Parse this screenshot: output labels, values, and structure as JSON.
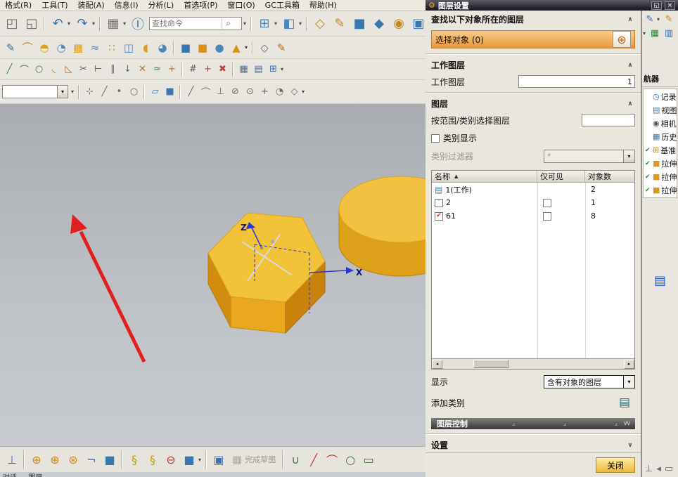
{
  "menu": {
    "items": [
      {
        "name": "menu-format",
        "label": "格式(R)"
      },
      {
        "name": "menu-tools",
        "label": "工具(T)"
      },
      {
        "name": "menu-assemblies",
        "label": "装配(A)"
      },
      {
        "name": "menu-information",
        "label": "信息(I)"
      },
      {
        "name": "menu-analysis",
        "label": "分析(L)"
      },
      {
        "name": "menu-preferences",
        "label": "首选项(P)"
      },
      {
        "name": "menu-window",
        "label": "窗口(O)"
      },
      {
        "name": "menu-gc-toolbox",
        "label": "GC工具箱"
      },
      {
        "name": "menu-help",
        "label": "帮助(H)"
      }
    ]
  },
  "icons": {
    "chevron_up": "∧",
    "chevron_down": "∨",
    "caret": "▾",
    "check": "✔",
    "gear": "⚙",
    "close": "×",
    "restore": "◱",
    "search": "⌕",
    "crosshair": "⊕",
    "layers": "▤",
    "sort": "▲",
    "scroll_left": "◂",
    "scroll_right": "▸",
    "tick": "⌟"
  },
  "toolbars": {
    "search_placeholder": "查找命令",
    "finish_sketch_label": "完成草图",
    "row1_left": [
      {
        "n": "paste-icon",
        "g": "◰",
        "c": "#6a6a6a"
      },
      {
        "n": "copy-icon",
        "g": "◱",
        "c": "#6a6a6a"
      },
      {
        "n": "separator",
        "g": "",
        "cls": "sep"
      },
      {
        "n": "undo-icon",
        "g": "↶",
        "c": "#2f6fb0"
      },
      {
        "n": "undo-caret-icon",
        "g": "▾",
        "c": "#444444",
        "cls": "caret"
      },
      {
        "n": "redo-icon",
        "g": "↷",
        "c": "#2f6fb0"
      },
      {
        "n": "redo-caret-icon",
        "g": "▾",
        "c": "#444444",
        "cls": "caret"
      },
      {
        "n": "separator",
        "g": "",
        "cls": "sep"
      },
      {
        "n": "command-finder-icon",
        "g": "▦",
        "c": "#777777"
      },
      {
        "n": "finder-caret-icon",
        "g": "▾",
        "c": "#444444",
        "cls": "caret"
      },
      {
        "n": "info-icon",
        "g": "Ⓘ",
        "c": "#2f6fb0"
      }
    ],
    "row1_right": [
      {
        "n": "search-caret-icon",
        "g": "▾",
        "c": "#444444",
        "cls": "caret"
      },
      {
        "n": "separator",
        "g": "",
        "cls": "sep"
      },
      {
        "n": "window-layout-icon",
        "g": "⊞",
        "c": "#4a86c0"
      },
      {
        "n": "layout-caret-icon",
        "g": "▾",
        "c": "#444444",
        "cls": "caret"
      },
      {
        "n": "render-style-icon",
        "g": "◧",
        "c": "#4a86c0"
      },
      {
        "n": "render-caret-icon",
        "g": "▾",
        "c": "#444444",
        "cls": "caret"
      },
      {
        "n": "separator",
        "g": "",
        "cls": "sep"
      },
      {
        "n": "datum-plane-icon",
        "g": "◇",
        "c": "#c08a20"
      },
      {
        "n": "sketch-icon",
        "g": "✎",
        "c": "#c08a20"
      },
      {
        "n": "extrude-icon",
        "g": "■",
        "c": "#3a76b0"
      },
      {
        "n": "revolve-icon",
        "g": "◆",
        "c": "#3a76b0"
      },
      {
        "n": "hole-icon",
        "g": "◉",
        "c": "#c08a20"
      },
      {
        "n": "block-icon",
        "g": "▣",
        "c": "#3a76b0"
      },
      {
        "n": "unite-icon",
        "g": "◫",
        "c": "#c08a20"
      },
      {
        "n": "shell-icon",
        "g": "◨",
        "c": "#3a76b0"
      },
      {
        "n": "edge-blend-icon",
        "g": "◢",
        "c": "#c08a20"
      },
      {
        "n": "more-caret-icon",
        "g": "▾",
        "c": "#444444",
        "cls": "caret"
      }
    ],
    "row2": [
      {
        "n": "sketch-curve-icon",
        "g": "✎",
        "c": "#2f6fb0"
      },
      {
        "n": "arc-tool-icon",
        "g": "⌒",
        "c": "#c08a20"
      },
      {
        "n": "studio-surface-icon",
        "g": "◓",
        "c": "#d8a020"
      },
      {
        "n": "swept-icon",
        "g": "◔",
        "c": "#4a86c0"
      },
      {
        "n": "mesh-surface-icon",
        "g": "▦",
        "c": "#d8a020"
      },
      {
        "n": "freeform-icon",
        "g": "≈",
        "c": "#4a86c0"
      },
      {
        "n": "pattern-icon",
        "g": "∷",
        "c": "#c08a20"
      },
      {
        "n": "mirror-icon",
        "g": "◫",
        "c": "#4a86c0"
      },
      {
        "n": "trim-body-icon",
        "g": "◖",
        "c": "#d8a020"
      },
      {
        "n": "blend-icon",
        "g": "◕",
        "c": "#4a86c0"
      },
      {
        "n": "separator",
        "g": "",
        "cls": "sep"
      },
      {
        "n": "cube-blue-icon",
        "g": "■",
        "c": "#3a76b0"
      },
      {
        "n": "cube-orange-icon",
        "g": "■",
        "c": "#d8921a"
      },
      {
        "n": "sphere-icon",
        "g": "●",
        "c": "#4a86c0"
      },
      {
        "n": "cone-icon",
        "g": "▲",
        "c": "#d8921a"
      },
      {
        "n": "tool-caret-icon",
        "g": "▾",
        "c": "#444444",
        "cls": "caret"
      },
      {
        "n": "separator",
        "g": "",
        "cls": "sep"
      },
      {
        "n": "wireframe-icon",
        "g": "◇",
        "c": "#6a6a6a"
      },
      {
        "n": "edit-feature-icon",
        "g": "✎",
        "c": "#b07020"
      }
    ],
    "row3": [
      {
        "n": "line-icon",
        "g": "╱",
        "c": "#3a7a3a"
      },
      {
        "n": "arc-icon",
        "g": "⌒",
        "c": "#3a7a3a"
      },
      {
        "n": "circle-icon",
        "g": "○",
        "c": "#3a7a3a"
      },
      {
        "n": "fillet-icon",
        "g": "◟",
        "c": "#b07020"
      },
      {
        "n": "chamfer-icon",
        "g": "◺",
        "c": "#b07020"
      },
      {
        "n": "quick-trim-icon",
        "g": "✂",
        "c": "#5a5a5a"
      },
      {
        "n": "extend-icon",
        "g": "⊢",
        "c": "#5a5a5a"
      },
      {
        "n": "offset-curve-icon",
        "g": "∥",
        "c": "#3a6fb0"
      },
      {
        "n": "project-curve-icon",
        "g": "↓",
        "c": "#3a6fb0"
      },
      {
        "n": "intersect-curve-icon",
        "g": "✕",
        "c": "#b07020"
      },
      {
        "n": "spline-icon",
        "g": "≈",
        "c": "#3a7a3a"
      },
      {
        "n": "point-icon",
        "g": "+",
        "c": "#b07020"
      },
      {
        "n": "separator",
        "g": "",
        "cls": "sep"
      },
      {
        "n": "measure-icon",
        "g": "#",
        "c": "#5a5a5a"
      },
      {
        "n": "move-object-icon",
        "g": "+",
        "c": "#b04030"
      },
      {
        "n": "delete-icon",
        "g": "✖",
        "c": "#b04030"
      },
      {
        "n": "separator",
        "g": "",
        "cls": "sep"
      },
      {
        "n": "view-grid-icon",
        "g": "▦",
        "c": "#3a6fb0"
      },
      {
        "n": "view-table-icon",
        "g": "▤",
        "c": "#3a6fb0"
      },
      {
        "n": "view-datum-icon",
        "g": "⊞",
        "c": "#3a6fb0"
      },
      {
        "n": "view-caret-icon",
        "g": "▾",
        "c": "#444444",
        "cls": "caret"
      }
    ],
    "row4": [
      {
        "n": "type-filter-caret-icon",
        "g": "▾",
        "c": "#444444",
        "cls": "caret"
      },
      {
        "n": "separator",
        "g": "",
        "cls": "sep"
      },
      {
        "n": "snap-point-icon",
        "g": "⊹",
        "c": "#6a6a6a"
      },
      {
        "n": "snap-end-icon",
        "g": "╱",
        "c": "#6a6a6a"
      },
      {
        "n": "snap-mid-icon",
        "g": "•",
        "c": "#6a6a6a"
      },
      {
        "n": "snap-ctrl-icon",
        "g": "○",
        "c": "#6a6a6a"
      },
      {
        "n": "separator",
        "g": "",
        "cls": "sep"
      },
      {
        "n": "plane-icon",
        "g": "▱",
        "c": "#3a76b0"
      },
      {
        "n": "body-icon",
        "g": "■",
        "c": "#3a76b0"
      },
      {
        "n": "separator",
        "g": "",
        "cls": "sep"
      },
      {
        "n": "snap-line-icon",
        "g": "╱",
        "c": "#6a6a6a"
      },
      {
        "n": "snap-arc-icon",
        "g": "⌒",
        "c": "#6a6a6a"
      },
      {
        "n": "snap-perp-icon",
        "g": "⊥",
        "c": "#6a6a6a"
      },
      {
        "n": "snap-tangent-icon",
        "g": "⊘",
        "c": "#6a6a6a"
      },
      {
        "n": "snap-center-icon",
        "g": "⊙",
        "c": "#6a6a6a"
      },
      {
        "n": "snap-intersection-icon",
        "g": "+",
        "c": "#6a6a6a"
      },
      {
        "n": "snap-quadrant-icon",
        "g": "◔",
        "c": "#6a6a6a"
      },
      {
        "n": "snap-existing-icon",
        "g": "◇",
        "c": "#6a6a6a"
      },
      {
        "n": "snap-caret-icon",
        "g": "▾",
        "c": "#444444",
        "cls": "caret"
      }
    ],
    "bottom_left": [
      {
        "n": "sketch-constraint-icon",
        "g": "⊥",
        "c": "#3a6fb0"
      },
      {
        "n": "separator",
        "g": "",
        "cls": "sep"
      },
      {
        "n": "auto-dimension-icon",
        "g": "⊕",
        "c": "#d08a10"
      },
      {
        "n": "snap-orange-icon",
        "g": "⊕",
        "c": "#d08a10"
      },
      {
        "n": "snap-orange2-icon",
        "g": "⊛",
        "c": "#d08a10"
      },
      {
        "n": "profile-icon",
        "g": "¬",
        "c": "#3a6fb0"
      },
      {
        "n": "solid-cube-icon",
        "g": "■",
        "c": "#3a76b0"
      },
      {
        "n": "separator",
        "g": "",
        "cls": "sep"
      },
      {
        "n": "clip-icon",
        "g": "§",
        "c": "#c0a000"
      },
      {
        "n": "clip2-icon",
        "g": "§",
        "c": "#c0a000"
      },
      {
        "n": "remove-icon",
        "g": "⊖",
        "c": "#b04030"
      },
      {
        "n": "cube-menu-icon",
        "g": "■",
        "c": "#3a76b0"
      },
      {
        "n": "cube-caret-icon",
        "g": "▾",
        "c": "#444444",
        "cls": "caret"
      },
      {
        "n": "separator",
        "g": "",
        "cls": "sep"
      },
      {
        "n": "sheet-icon",
        "g": "▣",
        "c": "#3a6fb0"
      }
    ],
    "bottom_right": [
      {
        "n": "separator",
        "g": "",
        "cls": "sep"
      },
      {
        "n": "curve-u-icon",
        "g": "∪",
        "c": "#3a7a3a"
      },
      {
        "n": "curve-line-icon",
        "g": "╱",
        "c": "#b04030"
      },
      {
        "n": "curve-arc-icon",
        "g": "⌒",
        "c": "#b04030"
      },
      {
        "n": "curve-circle-icon",
        "g": "○",
        "c": "#3a7a3a"
      },
      {
        "n": "curve-rect-icon",
        "g": "▭",
        "c": "#3a7a3a"
      }
    ]
  },
  "viewport": {
    "axis_z": "Z",
    "axis_x": "X"
  },
  "status_text": "对话 … 图层",
  "dialog": {
    "title": "图层设置",
    "find_header": "查找以下对象所在的图层",
    "select_object_label": "选择对象 (0)",
    "work_header": "工作图层",
    "work_label": "工作图层",
    "work_value": "1",
    "layers_header": "图层",
    "range_label": "按范围/类别选择图层",
    "range_value": "",
    "category_display_label": "类别显示",
    "category_filter_label": "类别过滤器",
    "category_filter_value": "*",
    "table": {
      "col_name": "名称",
      "col_visible": "仅可见",
      "col_count": "对象数",
      "rows": [
        {
          "name": "1(工作)",
          "count": "2"
        },
        {
          "name": "2",
          "count": "1"
        },
        {
          "name": "61",
          "count": "8"
        }
      ]
    },
    "show_label": "显示",
    "show_value": "含有对象的图层",
    "add_category_label": "添加类别",
    "layer_control_label": "图层控制",
    "settings_header": "设置",
    "close_label": "关闭"
  },
  "navigator": {
    "caption": "航器",
    "top_icons": [
      {
        "n": "nav-pencil-icon",
        "g": "✎",
        "c": "#2f6fb0"
      },
      {
        "n": "nav-caret-icon",
        "g": "▾",
        "c": "#444444",
        "cls": "caret"
      },
      {
        "n": "nav-pencil2-icon",
        "g": "✎",
        "c": "#c08a20"
      },
      {
        "n": "nav-caret2-icon",
        "g": "▾",
        "c": "#444444",
        "cls": "caret"
      },
      {
        "n": "nav-table-check-icon",
        "g": "▦",
        "c": "#3a8a3a"
      },
      {
        "n": "nav-sheet-icon",
        "g": "▥",
        "c": "#3a6fb0"
      }
    ],
    "items": [
      {
        "chk": "",
        "g": "◷",
        "c": "#3a6fb0",
        "label": "记录模式"
      },
      {
        "chk": "",
        "g": "▤",
        "c": "#3a6fb0",
        "label": "视图"
      },
      {
        "chk": "",
        "g": "◉",
        "c": "#555555",
        "label": "相机"
      },
      {
        "chk": "",
        "g": "▦",
        "c": "#3a6fb0",
        "label": "历史记"
      },
      {
        "chk": "✔",
        "g": "⊞",
        "c": "#c08a20",
        "label": "基准坐"
      },
      {
        "chk": "✔",
        "g": "■",
        "c": "#d89a20",
        "label": "拉伸 ("
      },
      {
        "chk": "✔",
        "g": "■",
        "c": "#d89a20",
        "label": "拉伸 ("
      },
      {
        "chk": "✔",
        "g": "■",
        "c": "#d89a20",
        "label": "拉伸 ("
      }
    ],
    "mid_icon": {
      "n": "strip-list-icon",
      "g": "▤",
      "c": "#2255cc"
    },
    "bottom_icons": [
      {
        "n": "strip-perp-icon",
        "g": "⊥",
        "c": "#6a6a6a"
      },
      {
        "n": "strip-corner-icon",
        "g": "◂",
        "c": "#6a6a6a"
      },
      {
        "n": "strip-rect-icon",
        "g": "▭",
        "c": "#6a6a6a"
      }
    ]
  }
}
